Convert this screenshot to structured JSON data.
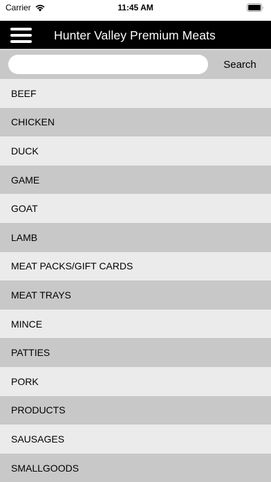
{
  "status_bar": {
    "carrier": "Carrier",
    "time": "11:45 AM",
    "icons": [
      "wifi-icon",
      "battery-icon"
    ]
  },
  "header": {
    "menu_icon": "hamburger-menu-icon",
    "title": "Hunter Valley Premium Meats"
  },
  "search": {
    "value": "",
    "placeholder": "",
    "button_label": "Search"
  },
  "categories": [
    "BEEF",
    "CHICKEN",
    "DUCK",
    "GAME",
    "GOAT",
    "LAMB",
    "MEAT PACKS/GIFT CARDS",
    "MEAT TRAYS",
    "MINCE",
    "PATTIES",
    "PORK",
    "PRODUCTS",
    "SAUSAGES",
    "SMALLGOODS"
  ],
  "colors": {
    "header_bg": "#000000",
    "header_text": "#ffffff",
    "row_light": "#ebebeb",
    "row_dark": "#c8c8c8"
  }
}
